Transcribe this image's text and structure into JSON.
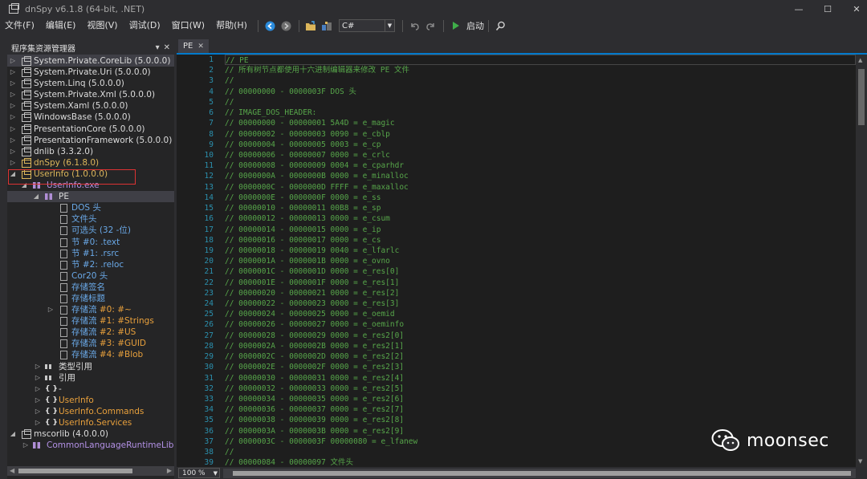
{
  "window": {
    "title": "dnSpy v6.1.8 (64-bit, .NET)",
    "min_label": "—",
    "max_label": "☐",
    "close_label": "✕"
  },
  "menu": [
    "文件(F)",
    "编辑(E)",
    "视图(V)",
    "调试(D)",
    "窗口(W)",
    "帮助(H)"
  ],
  "toolbar": {
    "language": "C#",
    "start_label": "启动"
  },
  "panel": {
    "title": "程序集资源管理器"
  },
  "tree": {
    "assemblies": [
      "System.Private.CoreLib (5.0.0.0)",
      "System.Private.Uri (5.0.0.0)",
      "System.Linq (5.0.0.0)",
      "System.Private.Xml (5.0.0.0)",
      "System.Xaml (5.0.0.0)",
      "WindowsBase (5.0.0.0)",
      "PresentationCore (5.0.0.0)",
      "PresentationFramework (5.0.0.0)",
      "dnlib (3.3.2.0)",
      "dnSpy (6.1.8.0)",
      "UserInfo (1.0.0.0)"
    ],
    "module": "UserInfo.exe",
    "pe": "PE",
    "pe_children": [
      "DOS 头",
      "文件头",
      "可选头 (32 -位)",
      "节 #0: .text",
      "节 #1: .rsrc",
      "节 #2: .reloc",
      "Cor20 头",
      "存储签名",
      "存储标题"
    ],
    "streams": [
      {
        "prefix": "存储流",
        "name": "#0: #~"
      },
      {
        "prefix": "存储流",
        "name": "#1: #Strings"
      },
      {
        "prefix": "存储流",
        "name": "#2: #US"
      },
      {
        "prefix": "存储流",
        "name": "#3: #GUID"
      },
      {
        "prefix": "存储流",
        "name": "#4: #Blob"
      }
    ],
    "typeref": "类型引用",
    "refs": "引用",
    "namespaces": [
      "-",
      "UserInfo",
      "UserInfo.Commands",
      "UserInfo.Services"
    ],
    "mscorlib": "mscorlib (4.0.0.0)",
    "mscorlib_child": "CommonLanguageRuntimeLibrar"
  },
  "doc_tab": {
    "title": "PE",
    "close": "✕"
  },
  "editor": {
    "line_numbers": [
      "1",
      "2",
      "3",
      "4",
      "5",
      "6",
      "7",
      "8",
      "9",
      "10",
      "11",
      "12",
      "13",
      "14",
      "15",
      "16",
      "17",
      "18",
      "19",
      "20",
      "21",
      "22",
      "23",
      "24",
      "25",
      "26",
      "27",
      "28",
      "29",
      "30",
      "31",
      "32",
      "33",
      "34",
      "35",
      "36",
      "37",
      "38",
      "39"
    ],
    "lines": [
      "// PE",
      "// 所有树节点都使用十六进制编辑器来修改 PE 文件",
      "//",
      "// 00000000 - 0000003F DOS 头",
      "//",
      "// IMAGE_DOS_HEADER:",
      "// 00000000 - 00000001 5A4D = e_magic",
      "// 00000002 - 00000003 0090 = e_cblp",
      "// 00000004 - 00000005 0003 = e_cp",
      "// 00000006 - 00000007 0000 = e_crlc",
      "// 00000008 - 00000009 0004 = e_cparhdr",
      "// 0000000A - 0000000B 0000 = e_minalloc",
      "// 0000000C - 0000000D FFFF = e_maxalloc",
      "// 0000000E - 0000000F 0000 = e_ss",
      "// 00000010 - 00000011 00B8 = e_sp",
      "// 00000012 - 00000013 0000 = e_csum",
      "// 00000014 - 00000015 0000 = e_ip",
      "// 00000016 - 00000017 0000 = e_cs",
      "// 00000018 - 00000019 0040 = e_lfarlc",
      "// 0000001A - 0000001B 0000 = e_ovno",
      "// 0000001C - 0000001D 0000 = e_res[0]",
      "// 0000001E - 0000001F 0000 = e_res[1]",
      "// 00000020 - 00000021 0000 = e_res[2]",
      "// 00000022 - 00000023 0000 = e_res[3]",
      "// 00000024 - 00000025 0000 = e_oemid",
      "// 00000026 - 00000027 0000 = e_oeminfo",
      "// 00000028 - 00000029 0000 = e_res2[0]",
      "// 0000002A - 0000002B 0000 = e_res2[1]",
      "// 0000002C - 0000002D 0000 = e_res2[2]",
      "// 0000002E - 0000002F 0000 = e_res2[3]",
      "// 00000030 - 00000031 0000 = e_res2[4]",
      "// 00000032 - 00000033 0000 = e_res2[5]",
      "// 00000034 - 00000035 0000 = e_res2[6]",
      "// 00000036 - 00000037 0000 = e_res2[7]",
      "// 00000038 - 00000039 0000 = e_res2[8]",
      "// 0000003A - 0000003B 0000 = e_res2[9]",
      "// 0000003C - 0000003F 00000080 = e_lfanew",
      "//",
      "// 00000084 - 00000097 文件头"
    ]
  },
  "status": {
    "zoom": "100 %"
  },
  "watermark": {
    "text": "moonsec"
  }
}
